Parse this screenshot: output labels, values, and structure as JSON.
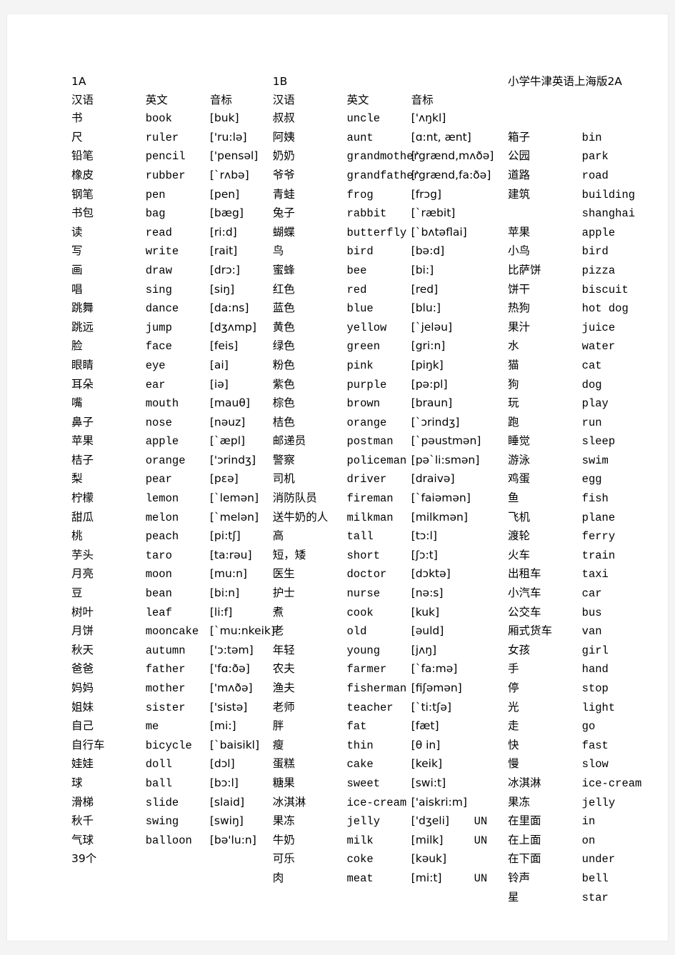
{
  "page": {
    "background": "#f4f4f4",
    "sheet_background": "#ffffff",
    "text_color": "#000000"
  },
  "blocks": [
    {
      "id": "1A",
      "title": "1A",
      "headers": {
        "chinese": "汉语",
        "english": "英文",
        "phonetic": "音标"
      },
      "footer": "39个",
      "rows": [
        {
          "cn": "书",
          "en": "book",
          "ph": "[buk]"
        },
        {
          "cn": "尺",
          "en": "ruler",
          "ph": "['ru:lə]"
        },
        {
          "cn": "铅笔",
          "en": "pencil",
          "ph": "['pensəl]"
        },
        {
          "cn": "橡皮",
          "en": "rubber",
          "ph": "[`rʌbə]"
        },
        {
          "cn": "钢笔",
          "en": "pen",
          "ph": "[pen]"
        },
        {
          "cn": "书包",
          "en": "bag",
          "ph": "[bæg]"
        },
        {
          "cn": "读",
          "en": "read",
          "ph": "[ri:d]"
        },
        {
          "cn": "写",
          "en": "write",
          "ph": "[rait]"
        },
        {
          "cn": "画",
          "en": "draw",
          "ph": "[drɔ:]"
        },
        {
          "cn": "唱",
          "en": "sing",
          "ph": "[siŋ]"
        },
        {
          "cn": "跳舞",
          "en": "dance",
          "ph": "[da:ns]"
        },
        {
          "cn": "跳远",
          "en": "jump",
          "ph": "[dʒʌmp]"
        },
        {
          "cn": "脸",
          "en": "face",
          "ph": "[feis]"
        },
        {
          "cn": "眼睛",
          "en": "eye",
          "ph": "[ai]"
        },
        {
          "cn": "耳朵",
          "en": "ear",
          "ph": "[iə]"
        },
        {
          "cn": "嘴",
          "en": "mouth",
          "ph": "[mauθ]"
        },
        {
          "cn": "鼻子",
          "en": "nose",
          "ph": "[nəuz]"
        },
        {
          "cn": "苹果",
          "en": "apple",
          "ph": "[`æpl]"
        },
        {
          "cn": "桔子",
          "en": "orange",
          "ph": "['ɔrindʒ]"
        },
        {
          "cn": "梨",
          "en": "pear",
          "ph": "[pɛə]"
        },
        {
          "cn": "柠檬",
          "en": "lemon",
          "ph": "[`lemən]"
        },
        {
          "cn": "甜瓜",
          "en": "melon",
          "ph": "[`melən]"
        },
        {
          "cn": "桃",
          "en": "peach",
          "ph": "[pi:tʃ]"
        },
        {
          "cn": "芋头",
          "en": "taro",
          "ph": "[ta:rəu]"
        },
        {
          "cn": "月亮",
          "en": "moon",
          "ph": "[mu:n]"
        },
        {
          "cn": "豆",
          "en": "bean",
          "ph": "[bi:n]"
        },
        {
          "cn": "树叶",
          "en": "leaf",
          "ph": "[li:f]"
        },
        {
          "cn": "月饼",
          "en": "mooncake",
          "ph": "[`mu:nkeik]"
        },
        {
          "cn": "秋天",
          "en": "autumn",
          "ph": "['ɔ:təm]"
        },
        {
          "cn": "爸爸",
          "en": "father",
          "ph": "['fɑ:ðə]"
        },
        {
          "cn": "妈妈",
          "en": "mother",
          "ph": "['mʌðə]"
        },
        {
          "cn": "姐妹",
          "en": "sister",
          "ph": "['sistə]"
        },
        {
          "cn": "自己",
          "en": "me",
          "ph": "[mi:]"
        },
        {
          "cn": "自行车",
          "en": "bicycle",
          "ph": "[`baisikl]"
        },
        {
          "cn": "娃娃",
          "en": "doll",
          "ph": "[dɔl]"
        },
        {
          "cn": "球",
          "en": "ball",
          "ph": "[bɔ:l]"
        },
        {
          "cn": "滑梯",
          "en": "slide",
          "ph": "[slaid]"
        },
        {
          "cn": "秋千",
          "en": "swing",
          "ph": "[swiŋ]"
        },
        {
          "cn": "气球",
          "en": "balloon",
          "ph": "[bə'lu:n]"
        }
      ]
    },
    {
      "id": "1B",
      "title": "1B",
      "headers": {
        "chinese": "汉语",
        "english": "英文",
        "phonetic": "音标"
      },
      "rows": [
        {
          "cn": "叔叔",
          "en": "uncle",
          "ph": "['ʌŋkl]"
        },
        {
          "cn": "阿姨",
          "en": "aunt",
          "ph": "[ɑ:nt, ænt]"
        },
        {
          "cn": "奶奶",
          "en": "grandmother",
          "ph": "['grænd,mʌðə]"
        },
        {
          "cn": "爷爷",
          "en": "grandfather",
          "ph": "['grænd,fa:ðə]"
        },
        {
          "cn": "青蛙",
          "en": "frog",
          "ph": "[frɔg]"
        },
        {
          "cn": "兔子",
          "en": "rabbit",
          "ph": "[`ræbit]"
        },
        {
          "cn": "蝴蝶",
          "en": "butterfly",
          "ph": "[`bʌtəflai]"
        },
        {
          "cn": "鸟",
          "en": "bird",
          "ph": "[bə:d]"
        },
        {
          "cn": "蜜蜂",
          "en": "bee",
          "ph": "[bi:]"
        },
        {
          "cn": "红色",
          "en": "red",
          "ph": "[red]"
        },
        {
          "cn": "蓝色",
          "en": "blue",
          "ph": "[blu:]"
        },
        {
          "cn": "黄色",
          "en": "yellow",
          "ph": "[`jeləu]"
        },
        {
          "cn": "绿色",
          "en": "green",
          "ph": "[gri:n]"
        },
        {
          "cn": "粉色",
          "en": "pink",
          "ph": "[piŋk]"
        },
        {
          "cn": "紫色",
          "en": "purple",
          "ph": "[pə:pl]"
        },
        {
          "cn": "棕色",
          "en": "brown",
          "ph": "[braun]"
        },
        {
          "cn": "桔色",
          "en": "orange",
          "ph": "[`ɔrindʒ]"
        },
        {
          "cn": "邮递员",
          "en": "postman",
          "ph": "[`pəustmən]"
        },
        {
          "cn": "警察",
          "en": "policeman",
          "ph": "[pə`li:smən]"
        },
        {
          "cn": "司机",
          "en": "driver",
          "ph": "[draivə]"
        },
        {
          "cn": "消防队员",
          "en": "fireman",
          "ph": "[`faiəmən]"
        },
        {
          "cn": "送牛奶的人",
          "en": "milkman",
          "ph": "[milkmən]"
        },
        {
          "cn": "高",
          "en": "tall",
          "ph": "[tɔ:l]"
        },
        {
          "cn": "短，矮",
          "en": "short",
          "ph": "[ʃɔ:t]",
          "ph_indent": true
        },
        {
          "cn": "医生",
          "en": "doctor",
          "ph": "[dɔktə]"
        },
        {
          "cn": "护士",
          "en": "nurse",
          "ph": "[nə:s]"
        },
        {
          "cn": "煮",
          "en": "cook",
          "ph": "[kuk]"
        },
        {
          "cn": "老",
          "en": "old",
          "ph": "[əuld]"
        },
        {
          "cn": "年轻",
          "en": "young",
          "ph": "[jʌŋ]"
        },
        {
          "cn": "农夫",
          "en": "farmer",
          "ph": "[`fa:mə]"
        },
        {
          "cn": "渔夫",
          "en": "fisherman",
          "ph": "[fiʃəmən]"
        },
        {
          "cn": "老师",
          "en": "teacher",
          "ph": "[`ti:tʃə]"
        },
        {
          "cn": "胖",
          "en": "fat",
          "ph": "[fæt]"
        },
        {
          "cn": "瘦",
          "en": "thin",
          "ph": "[θ in]"
        },
        {
          "cn": "蛋糕",
          "en": "cake",
          "ph": "[keik]"
        },
        {
          "cn": "糖果",
          "en": "sweet",
          "ph": "[swi:t]"
        },
        {
          "cn": "冰淇淋",
          "en": "ice-cream",
          "ph": "['aiskri:m]"
        },
        {
          "cn": "果冻",
          "en": "jelly",
          "ph": "['dʒeli]",
          "un": "UN"
        },
        {
          "cn": "牛奶",
          "en": "milk",
          "ph": "[milk]",
          "un": "UN"
        },
        {
          "cn": "可乐",
          "en": "coke",
          "ph": "[kəuk]"
        },
        {
          "cn": "肉",
          "en": "meat",
          "ph": "[mi:t]",
          "un": "UN"
        }
      ]
    },
    {
      "id": "2A",
      "title": "小学牛津英语上海版2A",
      "rows": [
        {
          "cn": "箱子",
          "en": "bin"
        },
        {
          "cn": "公园",
          "en": "park"
        },
        {
          "cn": "道路",
          "en": "road"
        },
        {
          "cn": "建筑",
          "en": "building"
        },
        {
          "cn": "",
          "en": "shanghai"
        },
        {
          "cn": "苹果",
          "en": "apple"
        },
        {
          "cn": "小鸟",
          "en": "bird"
        },
        {
          "cn": "比萨饼",
          "en": "pizza"
        },
        {
          "cn": "饼干",
          "en": "biscuit"
        },
        {
          "cn": "热狗",
          "en": "hot dog"
        },
        {
          "cn": "果汁",
          "en": "juice"
        },
        {
          "cn": "水",
          "en": "water"
        },
        {
          "cn": "猫",
          "en": "cat"
        },
        {
          "cn": "狗",
          "en": "dog"
        },
        {
          "cn": "玩",
          "en": "play"
        },
        {
          "cn": "跑",
          "en": "run"
        },
        {
          "cn": "睡觉",
          "en": "sleep"
        },
        {
          "cn": "游泳",
          "en": "swim"
        },
        {
          "cn": "鸡蛋",
          "en": "egg"
        },
        {
          "cn": "鱼",
          "en": "fish"
        },
        {
          "cn": "飞机",
          "en": "plane"
        },
        {
          "cn": "渡轮",
          "en": "ferry"
        },
        {
          "cn": "火车",
          "en": "train"
        },
        {
          "cn": "出租车",
          "en": "taxi"
        },
        {
          "cn": "小汽车",
          "en": "car"
        },
        {
          "cn": "公交车",
          "en": "bus"
        },
        {
          "cn": "厢式货车",
          "en": "van"
        },
        {
          "cn": "女孩",
          "en": "girl"
        },
        {
          "cn": "手",
          "en": "hand"
        },
        {
          "cn": "停",
          "en": "stop"
        },
        {
          "cn": "光",
          "en": "light"
        },
        {
          "cn": "走",
          "en": "go"
        },
        {
          "cn": "快",
          "en": "fast"
        },
        {
          "cn": "慢",
          "en": "slow"
        },
        {
          "cn": "冰淇淋",
          "en": "ice-cream"
        },
        {
          "cn": "果冻",
          "en": "jelly"
        },
        {
          "cn": "在里面",
          "en": "in"
        },
        {
          "cn": "在上面",
          "en": "on"
        },
        {
          "cn": "在下面",
          "en": "under"
        },
        {
          "cn": "铃声",
          "en": "bell"
        },
        {
          "cn": "星",
          "en": "star"
        }
      ]
    }
  ]
}
